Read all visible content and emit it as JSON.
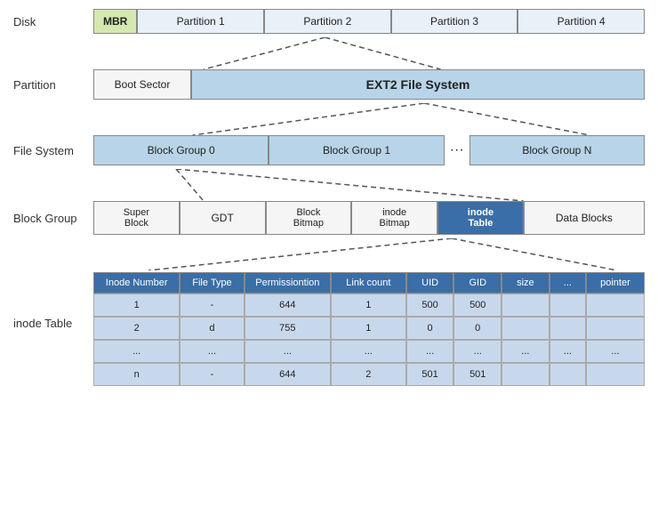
{
  "labels": {
    "disk": "Disk",
    "partition": "Partition",
    "filesystem": "File System",
    "blockgroup": "Block Group",
    "inodetable": "inode Table"
  },
  "disk": {
    "mbr": "MBR",
    "partitions": [
      "Partition 1",
      "Partition 2",
      "Partition 3",
      "Partition 4"
    ]
  },
  "partition": {
    "boot": "Boot Sector",
    "ext2": "EXT2 File System"
  },
  "filesystem": {
    "groups": [
      "Block Group 0",
      "Block Group 1",
      "Block Group N"
    ],
    "dots": "···"
  },
  "blockgroup": {
    "cells": [
      "Super\nBlock",
      "GDT",
      "Block\nBitmap",
      "inode\nBitmap",
      "inode\nTable",
      "Data Blocks"
    ]
  },
  "inodetable": {
    "headers": [
      "Inode Number",
      "File Type",
      "Permissiontion",
      "Link count",
      "UID",
      "GID",
      "size",
      "...",
      "pointer"
    ],
    "rows": [
      [
        "1",
        "-",
        "644",
        "1",
        "500",
        "500",
        "",
        "",
        ""
      ],
      [
        "2",
        "d",
        "755",
        "1",
        "0",
        "0",
        "",
        "",
        ""
      ],
      [
        "...",
        "...",
        "...",
        "...",
        "...",
        "...",
        "...",
        "...",
        "..."
      ],
      [
        "n",
        "-",
        "644",
        "2",
        "501",
        "501",
        "",
        "",
        ""
      ]
    ]
  }
}
